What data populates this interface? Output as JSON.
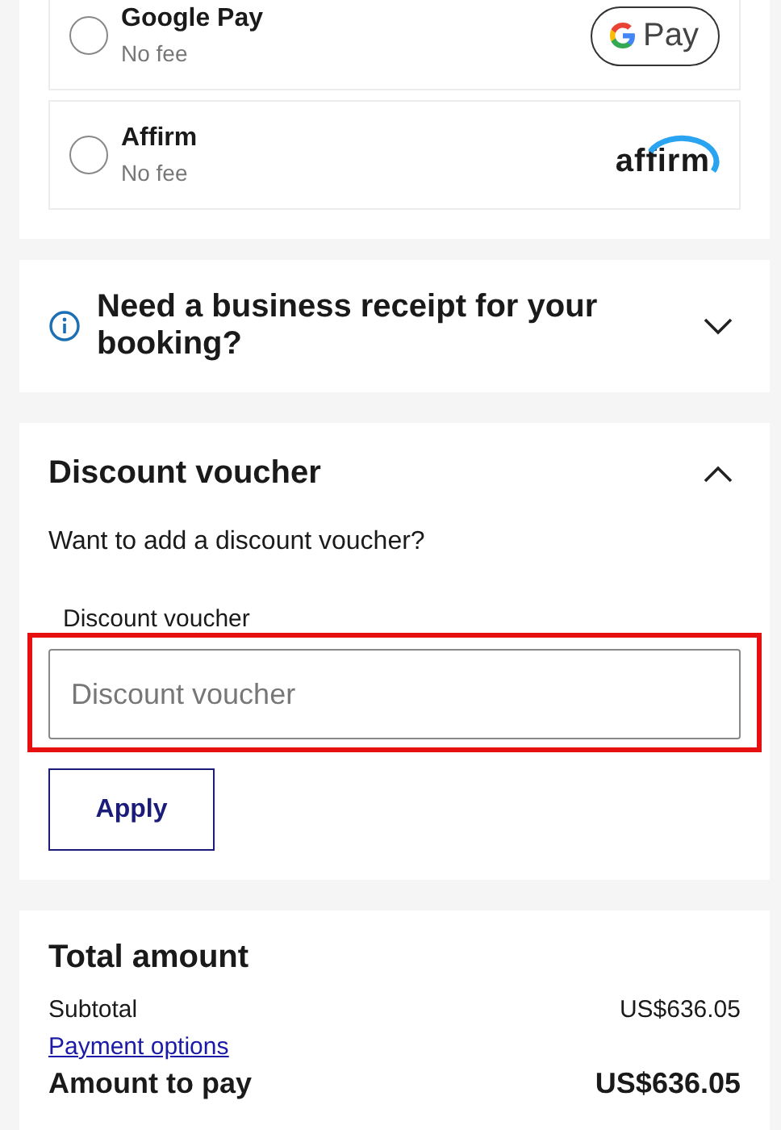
{
  "payment_methods": [
    {
      "name": "Google Pay",
      "fee": "No fee",
      "selected": false,
      "logo": {
        "kind": "gpay",
        "text": "Pay"
      }
    },
    {
      "name": "Affirm",
      "fee": "No fee",
      "selected": false,
      "logo": {
        "kind": "affirm",
        "text": "affirm"
      }
    }
  ],
  "business_receipt": {
    "title": "Need a business receipt for your booking?",
    "expanded": false
  },
  "discount_voucher": {
    "title": "Discount voucher",
    "expanded": true,
    "prompt": "Want to add a discount voucher?",
    "field_label": "Discount voucher",
    "placeholder": "Discount voucher",
    "highlighted": true,
    "button": "Apply"
  },
  "total": {
    "title": "Total amount",
    "rows": [
      {
        "kind": "line",
        "label": "Subtotal",
        "value": "US$636.05"
      },
      {
        "kind": "link",
        "label": "Payment options"
      },
      {
        "kind": "total",
        "label": "Amount to pay",
        "value": "US$636.05"
      }
    ]
  }
}
